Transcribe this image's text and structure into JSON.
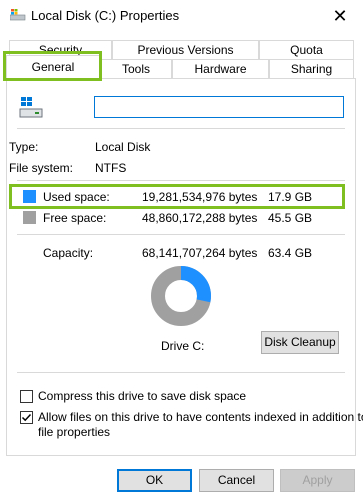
{
  "window": {
    "title": "Local Disk (C:) Properties",
    "close": "✕"
  },
  "tabs": {
    "back_row": [
      "Security",
      "Previous Versions",
      "Quota"
    ],
    "front_row": [
      "General",
      "Tools",
      "Hardware",
      "Sharing"
    ],
    "active": "General"
  },
  "general": {
    "name_value": "",
    "type_label": "Type:",
    "type_value": "Local Disk",
    "fs_label": "File system:",
    "fs_value": "NTFS",
    "used_label": "Used space:",
    "used_bytes": "19,281,534,976 bytes",
    "used_gb": "17.9 GB",
    "free_label": "Free space:",
    "free_bytes": "48,860,172,288 bytes",
    "free_gb": "45.5 GB",
    "capacity_label": "Capacity:",
    "capacity_bytes": "68,141,707,264 bytes",
    "capacity_gb": "63.4 GB",
    "drive_label": "Drive C:",
    "used_fraction": 0.283,
    "disk_cleanup": "Disk Cleanup",
    "compress_label": "Compress this drive to save disk space",
    "compress_checked": false,
    "index_label_line1": "Allow files on this drive to have contents indexed in addition to",
    "index_label_line2": "file properties",
    "index_checked": true
  },
  "colors": {
    "used": "#1e90ff",
    "free": "#a0a0a0",
    "highlight": "#7fbf1f"
  },
  "buttons": {
    "ok": "OK",
    "cancel": "Cancel",
    "apply": "Apply"
  }
}
